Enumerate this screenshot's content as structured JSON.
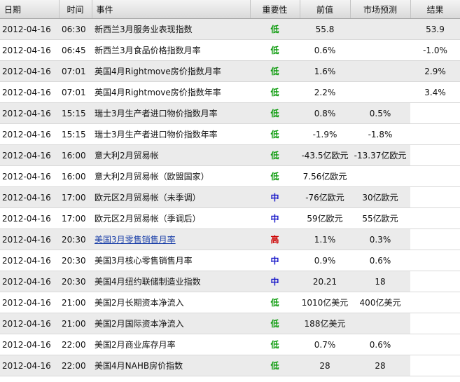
{
  "columns": [
    "日期",
    "时间",
    "事件",
    "重要性",
    "前值",
    "市场预测",
    "结果"
  ],
  "colors": {
    "low": "#0a9a0a",
    "medium": "#1515c8",
    "high": "#cc0000",
    "link": "#1a3fa8"
  },
  "rows": [
    {
      "date": "2012-04-16",
      "time": "06:30",
      "event": "新西兰3月服务业表现指数",
      "importance": "低",
      "level": "low",
      "previous": "55.8",
      "forecast": "",
      "result": "53.9",
      "link": false
    },
    {
      "date": "2012-04-16",
      "time": "06:45",
      "event": "新西兰3月食品价格指数月率",
      "importance": "低",
      "level": "low",
      "previous": "0.6%",
      "forecast": "",
      "result": "-1.0%",
      "link": false
    },
    {
      "date": "2012-04-16",
      "time": "07:01",
      "event": "英国4月Rightmove房价指数月率",
      "importance": "低",
      "level": "low",
      "previous": "1.6%",
      "forecast": "",
      "result": "2.9%",
      "link": false
    },
    {
      "date": "2012-04-16",
      "time": "07:01",
      "event": "英国4月Rightmove房价指数年率",
      "importance": "低",
      "level": "low",
      "previous": "2.2%",
      "forecast": "",
      "result": "3.4%",
      "link": false
    },
    {
      "date": "2012-04-16",
      "time": "15:15",
      "event": "瑞士3月生产者进口物价指数月率",
      "importance": "低",
      "level": "low",
      "previous": "0.8%",
      "forecast": "0.5%",
      "result": "",
      "link": false
    },
    {
      "date": "2012-04-16",
      "time": "15:15",
      "event": "瑞士3月生产者进口物价指数年率",
      "importance": "低",
      "level": "low",
      "previous": "-1.9%",
      "forecast": "-1.8%",
      "result": "",
      "link": false
    },
    {
      "date": "2012-04-16",
      "time": "16:00",
      "event": "意大利2月贸易帐",
      "importance": "低",
      "level": "low",
      "previous": "-43.5亿欧元",
      "forecast": "-13.37亿欧元",
      "result": "",
      "link": false
    },
    {
      "date": "2012-04-16",
      "time": "16:00",
      "event": "意大利2月贸易帐（欧盟国家）",
      "importance": "低",
      "level": "low",
      "previous": "7.56亿欧元",
      "forecast": "",
      "result": "",
      "link": false
    },
    {
      "date": "2012-04-16",
      "time": "17:00",
      "event": "欧元区2月贸易帐（未季调）",
      "importance": "中",
      "level": "medium",
      "previous": "-76亿欧元",
      "forecast": "30亿欧元",
      "result": "",
      "link": false
    },
    {
      "date": "2012-04-16",
      "time": "17:00",
      "event": "欧元区2月贸易帐（季调后）",
      "importance": "中",
      "level": "medium",
      "previous": "59亿欧元",
      "forecast": "55亿欧元",
      "result": "",
      "link": false
    },
    {
      "date": "2012-04-16",
      "time": "20:30",
      "event": "美国3月零售销售月率",
      "importance": "高",
      "level": "high",
      "previous": "1.1%",
      "forecast": "0.3%",
      "result": "",
      "link": true
    },
    {
      "date": "2012-04-16",
      "time": "20:30",
      "event": "美国3月核心零售销售月率",
      "importance": "中",
      "level": "medium",
      "previous": "0.9%",
      "forecast": "0.6%",
      "result": "",
      "link": false
    },
    {
      "date": "2012-04-16",
      "time": "20:30",
      "event": "美国4月纽约联储制造业指数",
      "importance": "中",
      "level": "medium",
      "previous": "20.21",
      "forecast": "18",
      "result": "",
      "link": false
    },
    {
      "date": "2012-04-16",
      "time": "21:00",
      "event": "美国2月长期资本净流入",
      "importance": "低",
      "level": "low",
      "previous": "1010亿美元",
      "forecast": "400亿美元",
      "result": "",
      "link": false
    },
    {
      "date": "2012-04-16",
      "time": "21:00",
      "event": "美国2月国际资本净流入",
      "importance": "低",
      "level": "low",
      "previous": "188亿美元",
      "forecast": "",
      "result": "",
      "link": false
    },
    {
      "date": "2012-04-16",
      "time": "22:00",
      "event": "美国2月商业库存月率",
      "importance": "低",
      "level": "low",
      "previous": "0.7%",
      "forecast": "0.6%",
      "result": "",
      "link": false
    },
    {
      "date": "2012-04-16",
      "time": "22:00",
      "event": "美国4月NAHB房价指数",
      "importance": "低",
      "level": "low",
      "previous": "28",
      "forecast": "28",
      "result": "",
      "link": false
    }
  ]
}
